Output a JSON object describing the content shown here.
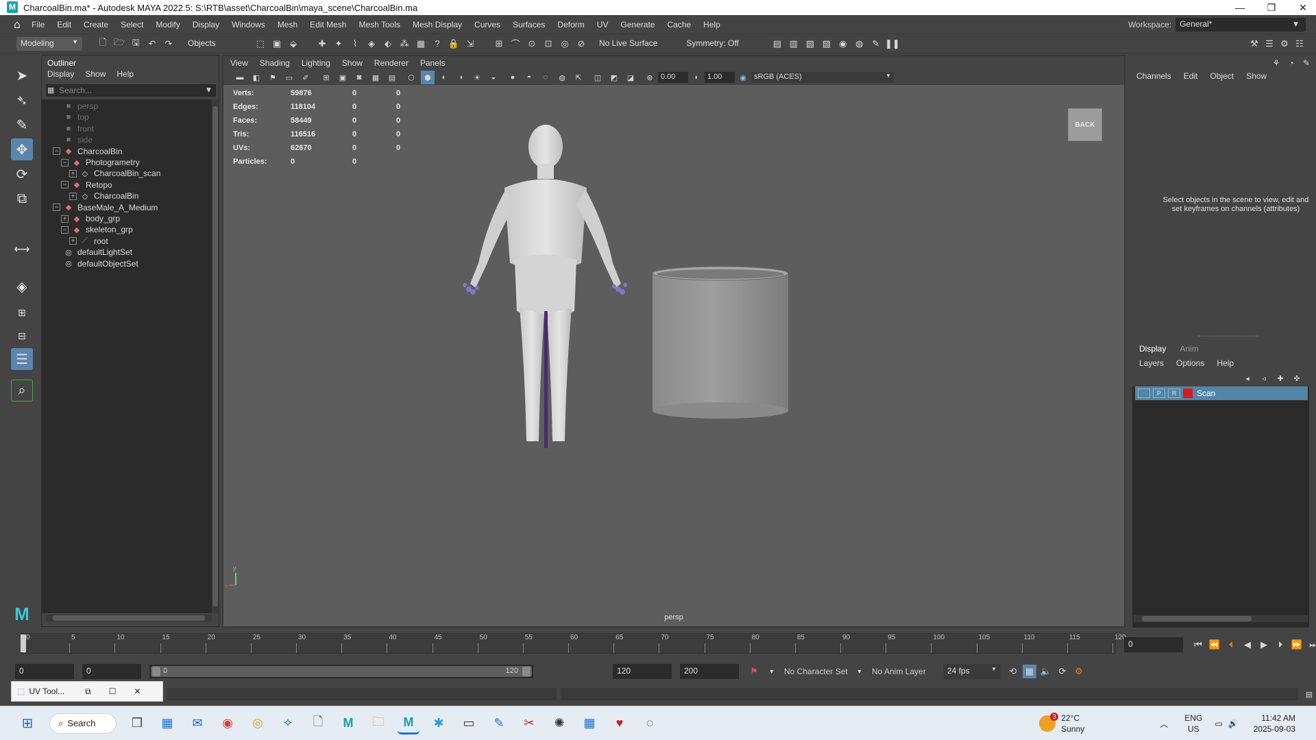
{
  "window": {
    "title": "CharcoalBin.ma* - Autodesk MAYA 2022.5: S:\\RTB\\asset\\CharcoalBin\\maya_scene\\CharcoalBin.ma",
    "app_icon": "M"
  },
  "menubar": {
    "items": [
      "File",
      "Edit",
      "Create",
      "Select",
      "Modify",
      "Display",
      "Windows",
      "Mesh",
      "Edit Mesh",
      "Mesh Tools",
      "Mesh Display",
      "Curves",
      "Surfaces",
      "Deform",
      "UV",
      "Generate",
      "Cache",
      "Help"
    ],
    "workspace_label": "Workspace:",
    "workspace_value": "General*"
  },
  "statusline": {
    "menuset": "Modeling",
    "selection_mode": "Objects",
    "live_surface": "No Live Surface",
    "symmetry": "Symmetry: Off"
  },
  "outliner": {
    "title": "Outliner",
    "menu": [
      "Display",
      "Show",
      "Help"
    ],
    "search_placeholder": "Search...",
    "nodes": [
      {
        "label": "persp",
        "indent": 0,
        "type": "camera",
        "dim": true,
        "expander": ""
      },
      {
        "label": "top",
        "indent": 0,
        "type": "camera",
        "dim": true,
        "expander": ""
      },
      {
        "label": "front",
        "indent": 0,
        "type": "camera",
        "dim": true,
        "expander": ""
      },
      {
        "label": "side",
        "indent": 0,
        "type": "camera",
        "dim": true,
        "expander": ""
      },
      {
        "label": "CharcoalBin",
        "indent": 0,
        "type": "group",
        "dim": false,
        "expander": "−"
      },
      {
        "label": "Photogrametry",
        "indent": 1,
        "type": "group",
        "dim": false,
        "expander": "−"
      },
      {
        "label": "CharcoalBin_scan",
        "indent": 2,
        "type": "mesh",
        "dim": false,
        "expander": "+"
      },
      {
        "label": "Retopo",
        "indent": 1,
        "type": "group",
        "dim": false,
        "expander": "−"
      },
      {
        "label": "CharcoalBin",
        "indent": 2,
        "type": "mesh",
        "dim": false,
        "expander": "+"
      },
      {
        "label": "BaseMale_A_Medium",
        "indent": 0,
        "type": "group",
        "dim": false,
        "expander": "−"
      },
      {
        "label": "body_grp",
        "indent": 1,
        "type": "group",
        "dim": false,
        "expander": "+"
      },
      {
        "label": "skeleton_grp",
        "indent": 1,
        "type": "group",
        "dim": false,
        "expander": "−"
      },
      {
        "label": "root",
        "indent": 2,
        "type": "joint",
        "dim": false,
        "expander": "+"
      },
      {
        "label": "defaultLightSet",
        "indent": 0,
        "type": "set",
        "dim": false,
        "expander": ""
      },
      {
        "label": "defaultObjectSet",
        "indent": 0,
        "type": "set",
        "dim": false,
        "expander": ""
      }
    ]
  },
  "viewport": {
    "menu": [
      "View",
      "Shading",
      "Lighting",
      "Show",
      "Renderer",
      "Panels"
    ],
    "exposure": "0.00",
    "gamma": "1.00",
    "color_space": "sRGB (ACES)",
    "hud": [
      {
        "label": "Verts:",
        "v1": "59876",
        "v2": "0",
        "v3": "0"
      },
      {
        "label": "Edges:",
        "v1": "118104",
        "v2": "0",
        "v3": "0"
      },
      {
        "label": "Faces:",
        "v1": "58449",
        "v2": "0",
        "v3": "0"
      },
      {
        "label": "Tris:",
        "v1": "116516",
        "v2": "0",
        "v3": "0"
      },
      {
        "label": "UVs:",
        "v1": "62670",
        "v2": "0",
        "v3": "0"
      },
      {
        "label": "Particles:",
        "v1": "0",
        "v2": "0",
        "v3": ""
      }
    ],
    "viewcube_label": "BACK",
    "camera_label": "persp"
  },
  "channelbox": {
    "menu": [
      "Channels",
      "Edit",
      "Object",
      "Show"
    ],
    "message": "Select objects in the scene to view, edit and set keyframes on channels (attributes)"
  },
  "layers": {
    "tabs": [
      "Display",
      "Anim"
    ],
    "menu": [
      "Layers",
      "Options",
      "Help"
    ],
    "row": {
      "v": "",
      "p": "P",
      "r": "R",
      "name": "Scan",
      "color": "#e01818"
    }
  },
  "timeslider": {
    "ticks": [
      "0",
      "5",
      "10",
      "15",
      "20",
      "25",
      "30",
      "35",
      "40",
      "45",
      "50",
      "55",
      "60",
      "65",
      "70",
      "75",
      "80",
      "85",
      "90",
      "95",
      "100",
      "105",
      "110",
      "115",
      "120"
    ],
    "current_frame": "0"
  },
  "rangeslider": {
    "start": "0",
    "playback_start": "0",
    "slider_start": "0",
    "slider_end": "120",
    "playback_end": "120",
    "end": "200",
    "character_set": "No Character Set",
    "anim_layer": "No Anim Layer",
    "fps": "24 fps"
  },
  "uv_toolkit": {
    "label": "UV Tool..."
  },
  "taskbar": {
    "search_label": "Search",
    "weather_temp": "22°C",
    "weather_text": "Sunny",
    "weather_badge": "3",
    "lang": "ENG",
    "region": "US",
    "time": "11:42 AM",
    "date": "2025-09-03"
  }
}
